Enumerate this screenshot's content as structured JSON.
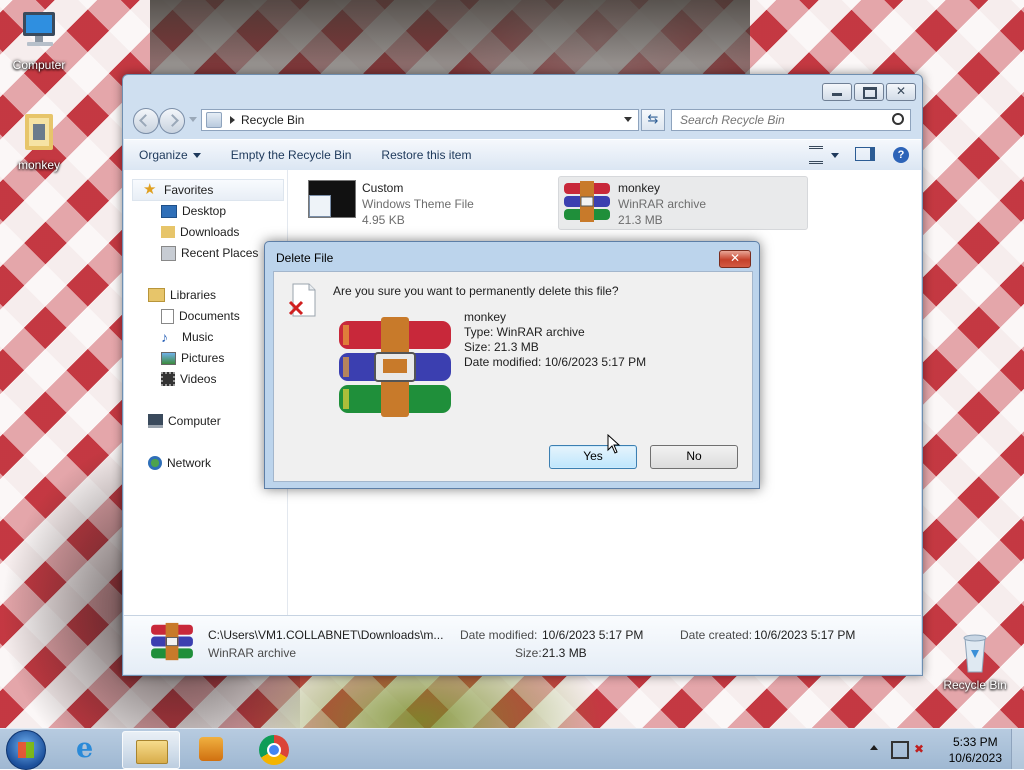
{
  "desktop": {
    "icons": [
      {
        "label": "Computer",
        "icon": "computer-icon"
      },
      {
        "label": "monkey",
        "icon": "folder-icon"
      },
      {
        "label": "Recycle Bin",
        "icon": "recycle-bin-icon"
      }
    ]
  },
  "explorer": {
    "address": "Recycle Bin",
    "search_placeholder": "Search Recycle Bin",
    "toolbar": {
      "organize": "Organize",
      "empty": "Empty the Recycle Bin",
      "restore": "Restore this item"
    },
    "nav": {
      "favorites": "Favorites",
      "desktop": "Desktop",
      "downloads": "Downloads",
      "recent": "Recent Places",
      "libraries": "Libraries",
      "documents": "Documents",
      "music": "Music",
      "pictures": "Pictures",
      "videos": "Videos",
      "computer": "Computer",
      "network": "Network"
    },
    "files": [
      {
        "name": "Custom",
        "type": "Windows Theme File",
        "size": "4.95 KB"
      },
      {
        "name": "monkey",
        "type": "WinRAR archive",
        "size": "21.3 MB"
      }
    ],
    "details": {
      "path": "C:\\Users\\VM1.COLLABNET\\Downloads\\m...",
      "type": "WinRAR archive",
      "modified_label": "Date modified:",
      "modified_value": "10/6/2023 5:17 PM",
      "size_label": "Size:",
      "size_value": "21.3 MB",
      "created_label": "Date created:",
      "created_value": "10/6/2023 5:17 PM"
    }
  },
  "dialog": {
    "title": "Delete File",
    "close": "✕",
    "question": "Are you sure you want to permanently delete this file?",
    "file_name": "monkey",
    "file_type": "Type: WinRAR archive",
    "file_size": "Size: 21.3 MB",
    "file_date": "Date modified: 10/6/2023 5:17 PM",
    "yes": "Yes",
    "no": "No"
  },
  "taskbar": {
    "time": "5:33 PM",
    "date": "10/6/2023"
  }
}
